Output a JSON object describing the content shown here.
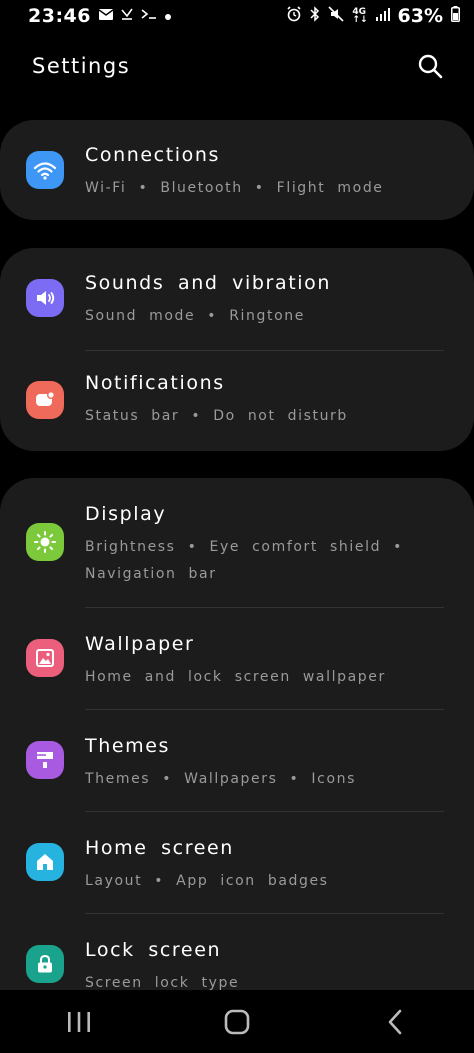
{
  "status_bar": {
    "time": "23:46",
    "left_icons": [
      "mail-icon",
      "missed-call-icon",
      "terminal-icon",
      "dot-icon"
    ],
    "right_icons": [
      "alarm-icon",
      "bluetooth-icon",
      "mute-icon",
      "4g-icon",
      "signal-icon"
    ],
    "battery": "63%"
  },
  "header": {
    "title": "Settings"
  },
  "colors": {
    "connections": "#3e97f5",
    "sounds": "#7c6cf3",
    "notifications": "#ef6a5a",
    "display": "#7cc93b",
    "wallpaper": "#eb5f7d",
    "themes": "#a85ae0",
    "home_screen": "#27b3e0",
    "lock_screen": "#19a28c",
    "card_bg": "#1c1c1c"
  },
  "cards": {
    "connections": {
      "title": "Connections",
      "subtitle": "Wi-Fi  •  Bluetooth  •  Flight mode",
      "icon": "wifi-icon"
    },
    "sounds": {
      "title": "Sounds and vibration",
      "subtitle": "Sound mode  •  Ringtone",
      "icon": "speaker-icon"
    },
    "notifications": {
      "title": "Notifications",
      "subtitle": "Status bar  •  Do not disturb",
      "icon": "notification-icon"
    },
    "display": {
      "title": "Display",
      "subtitle_line1": "Brightness  •  Eye comfort shield  •",
      "subtitle_line2": "Navigation bar",
      "icon": "sun-icon"
    },
    "wallpaper": {
      "title": "Wallpaper",
      "subtitle": "Home and lock screen wallpaper",
      "icon": "image-icon"
    },
    "themes": {
      "title": "Themes",
      "subtitle": "Themes  •  Wallpapers  •  Icons",
      "icon": "paintbrush-icon"
    },
    "home_screen": {
      "title": "Home screen",
      "subtitle": "Layout  •  App icon badges",
      "icon": "home-icon"
    },
    "lock_screen": {
      "title": "Lock screen",
      "subtitle": "Screen lock type",
      "icon": "lock-icon"
    }
  },
  "nav_bar": {
    "buttons": [
      "recents-icon",
      "home-button-icon",
      "back-icon"
    ]
  }
}
